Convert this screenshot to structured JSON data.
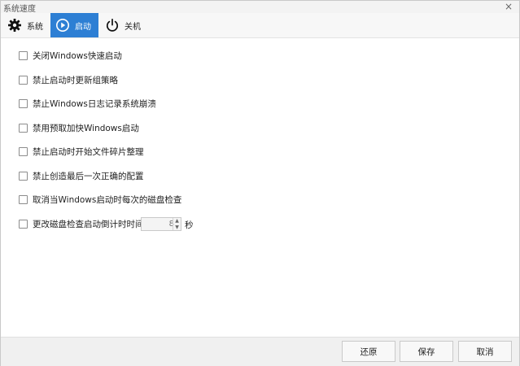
{
  "window": {
    "title": "系统速度",
    "close_glyph": "×"
  },
  "toolbar": {
    "tabs": [
      {
        "label": "系统",
        "icon": "gear-icon",
        "active": false
      },
      {
        "label": "启动",
        "icon": "play-circle-icon",
        "active": true
      },
      {
        "label": "关机",
        "icon": "power-icon",
        "active": false
      }
    ]
  },
  "options": [
    {
      "label": "关闭Windows快速启动",
      "checked": false
    },
    {
      "label": "禁止启动时更新组策略",
      "checked": false
    },
    {
      "label": "禁止Windows日志记录系统崩溃",
      "checked": false
    },
    {
      "label": "禁用预取加快Windows启动",
      "checked": false
    },
    {
      "label": "禁止启动时开始文件碎片整理",
      "checked": false
    },
    {
      "label": "禁止创造最后一次正确的配置",
      "checked": false
    },
    {
      "label": "取消当Windows启动时每次的磁盘检查",
      "checked": false
    },
    {
      "label": "更改磁盘检查启动倒计时时间",
      "checked": false
    }
  ],
  "countdown": {
    "value": "8",
    "unit": "秒"
  },
  "footer": {
    "restore": "还原",
    "save": "保存",
    "cancel": "取消"
  },
  "colors": {
    "accent": "#2d7fd4"
  }
}
